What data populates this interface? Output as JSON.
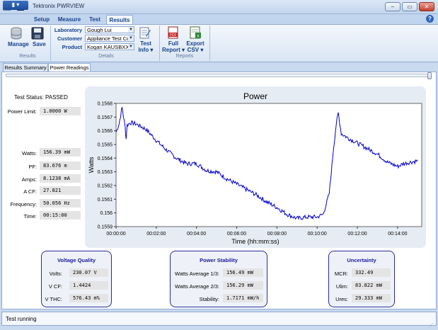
{
  "window": {
    "title": "Tektronix PWRVIEW",
    "min": "–",
    "max": "▭",
    "close": "✕"
  },
  "ribbon": {
    "tabs": [
      "Setup",
      "Measure",
      "Test",
      "Results"
    ],
    "active_tab": "Results",
    "help": "?",
    "results_group": {
      "manage": "Manage",
      "save": "Save",
      "label": "Results"
    },
    "details_group": {
      "label": "Details",
      "laboratory_label": "Laboratory",
      "laboratory_value": "Gough Lui",
      "customer_label": "Customer",
      "customer_value": "Appliance Test Co",
      "product_label": "Product",
      "product_value": "Kogan KAUSBXXA",
      "test_info_1": "Test",
      "test_info_2": "Info ▾"
    },
    "reports_group": {
      "label": "Reports",
      "full_report_1": "Full",
      "full_report_2": "Report ▾",
      "export_1": "Export",
      "export_2": "CSV ▾"
    }
  },
  "doc_tabs": [
    "Results Summary",
    "Power Readings"
  ],
  "active_doc_tab": "Power Readings",
  "left": {
    "test_status": "Test Status: PASSED",
    "power_limit_label": "Power Limit:",
    "power_limit_value": "1.0000 W",
    "readings": [
      {
        "label": "Watts:",
        "value": "156.39 mW"
      },
      {
        "label": "PF:",
        "value": "83.676 m"
      },
      {
        "label": "Amps:",
        "value": "8.1238 mA"
      },
      {
        "label": "A CF:",
        "value": "27.821"
      },
      {
        "label": "Frequency:",
        "value": "50.056 Hz"
      },
      {
        "label": "Time:",
        "value": "00:15:00"
      }
    ]
  },
  "voltage_quality": {
    "title": "Voltage Quality",
    "rows": [
      {
        "label": "Volts:",
        "value": "230.07 V"
      },
      {
        "label": "V CF:",
        "value": "1.4424"
      },
      {
        "label": "V THC:",
        "value": "576.43 m%"
      }
    ]
  },
  "power_stability": {
    "title": "Power Stability",
    "rows": [
      {
        "label": "Watts Average 1/3:",
        "value": "156.49 mW"
      },
      {
        "label": "Watts Average 2/3:",
        "value": "156.29 mW"
      },
      {
        "label": "Stability:",
        "value": "1.7171 mW/h"
      }
    ]
  },
  "uncertainty": {
    "title": "Uncertainty",
    "rows": [
      {
        "label": "MCR:",
        "value": "332.49"
      },
      {
        "label": "Ulim:",
        "value": "83.822 mW"
      },
      {
        "label": "Ures:",
        "value": "29.333 mW"
      }
    ]
  },
  "status": {
    "text": "Test running"
  },
  "chart_data": {
    "type": "line",
    "title": "Power",
    "xlabel": "Time (hh:mm:ss)",
    "ylabel": "Watts",
    "color": "#0000cc",
    "grid": false,
    "xlim": [
      0,
      15.2
    ],
    "ylim": [
      0.1559,
      0.1568
    ],
    "x_ticks": [
      0,
      2,
      4,
      6,
      8,
      10,
      12,
      14
    ],
    "x_tick_labels": [
      "00:00:00",
      "00:02:00",
      "00:04:00",
      "00:06:00",
      "00:08:00",
      "00:10:00",
      "00:12:00",
      "00:14:00"
    ],
    "y_ticks": [
      0.1559,
      0.156,
      0.1561,
      0.1562,
      0.1563,
      0.1564,
      0.1565,
      0.1566,
      0.1567,
      0.1568
    ],
    "y_tick_labels": [
      "0.1559",
      "0.156",
      "0.1561",
      "0.1562",
      "0.1563",
      "0.1564",
      "0.1565",
      "0.1566",
      "0.1567",
      "0.1568"
    ],
    "series": [
      {
        "x": [
          0,
          0.15,
          0.3,
          0.45,
          0.5,
          0.55,
          0.7,
          1.0,
          1.5,
          2.0,
          2.5,
          3.0,
          3.5,
          4.0,
          4.5,
          5.0,
          5.5,
          6.0,
          6.5,
          7.0,
          7.5,
          8.0,
          8.5,
          9.0,
          9.5,
          10.0,
          10.3,
          10.6,
          10.8,
          10.95,
          11.05,
          11.2,
          11.5,
          12.0,
          12.5,
          13.0,
          13.5,
          14.0,
          14.3,
          14.6,
          15.0
        ],
        "y": [
          0.15659,
          0.15665,
          0.15677,
          0.15663,
          0.15654,
          0.15664,
          0.15666,
          0.15665,
          0.15661,
          0.15653,
          0.15646,
          0.1564,
          0.15636,
          0.15636,
          0.15631,
          0.1563,
          0.15625,
          0.15621,
          0.15617,
          0.15613,
          0.15608,
          0.15604,
          0.15599,
          0.15596,
          0.15597,
          0.15597,
          0.15599,
          0.15614,
          0.15645,
          0.15665,
          0.15673,
          0.15658,
          0.15655,
          0.15651,
          0.15647,
          0.15643,
          0.15637,
          0.15634,
          0.15636,
          0.15637,
          0.15638
        ]
      }
    ]
  }
}
